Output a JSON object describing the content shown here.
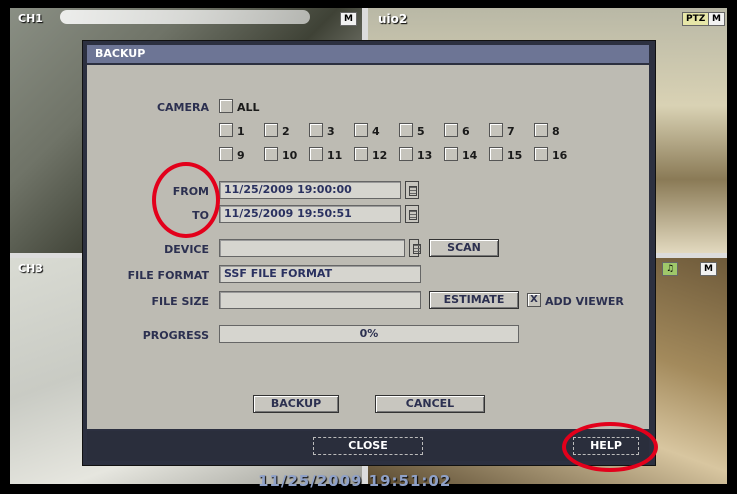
{
  "cameras": {
    "ch1": "CH1",
    "ch3": "CH3",
    "ch2_name": "uio2",
    "badge_m": "M",
    "badge_ptz": "PTZ"
  },
  "dialog": {
    "title": "BACKUP",
    "camera_label": "CAMERA",
    "all_label": "ALL",
    "channels_row1": [
      "1",
      "2",
      "3",
      "4",
      "5",
      "6",
      "7",
      "8"
    ],
    "channels_row2": [
      "9",
      "10",
      "11",
      "12",
      "13",
      "14",
      "15",
      "16"
    ],
    "from_label": "FROM",
    "from_value": "11/25/2009 19:00:00",
    "to_label": "TO",
    "to_value": "11/25/2009 19:50:51",
    "device_label": "DEVICE",
    "device_value": "",
    "scan_label": "SCAN",
    "file_format_label": "FILE FORMAT",
    "file_format_value": "SSF FILE FORMAT",
    "file_size_label": "FILE SIZE",
    "file_size_value": "",
    "estimate_label": "ESTIMATE",
    "add_viewer_label": "ADD VIEWER",
    "add_viewer_mark": "X",
    "progress_label": "PROGRESS",
    "progress_value": "0%",
    "backup_label": "BACKUP",
    "cancel_label": "CANCEL",
    "close_label": "CLOSE",
    "help_label": "HELP"
  },
  "timestamp": "11/25/2009 19:51:02",
  "colors": {
    "annotation": "#e3001b",
    "title_bar": "#6d7595",
    "panel": "#bdbbb3"
  }
}
